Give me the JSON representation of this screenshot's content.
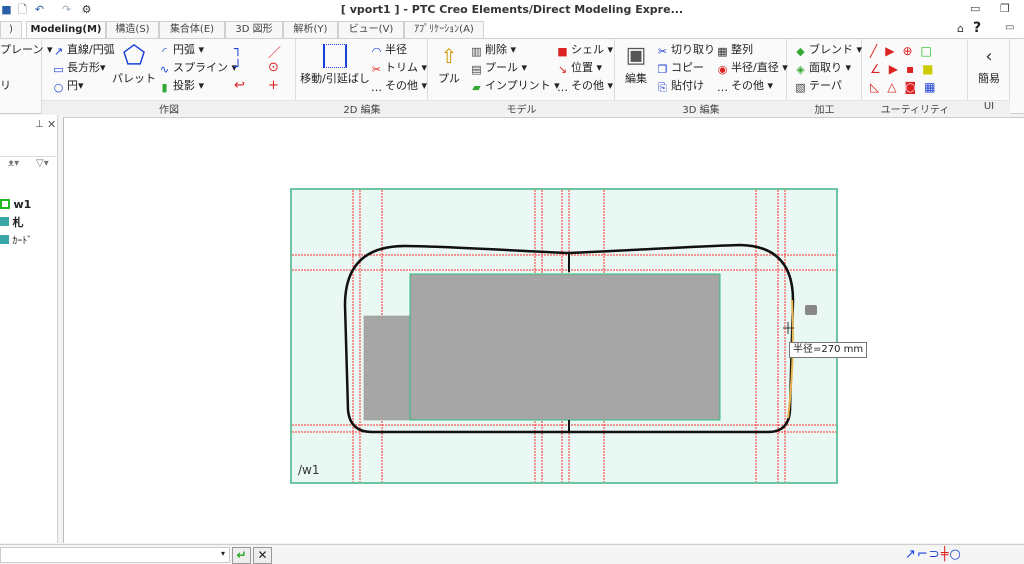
{
  "window": {
    "title": "[ vport1 ] - PTC Creo Elements/Direct Modeling Expre..."
  },
  "quick_access": [
    {
      "icon": "save-icon"
    },
    {
      "icon": "print-preview-icon"
    },
    {
      "icon": "undo-icon"
    },
    {
      "icon": "redo-icon"
    },
    {
      "icon": "settings-icon"
    }
  ],
  "tabs": [
    {
      "label": ")"
    },
    {
      "label": "Modeling(M)",
      "active": true
    },
    {
      "label": "構造(S)"
    },
    {
      "label": "集合体(E)"
    },
    {
      "label": "3D 図形"
    },
    {
      "label": "解析(Y)"
    },
    {
      "label": "ビュー(V)"
    },
    {
      "label": "ｱﾌﾟﾘｹｰｼｮﾝ(A)"
    }
  ],
  "ribbon": {
    "partial": {
      "items": [
        "プレーン ▾",
        "リ"
      ]
    },
    "drawing": {
      "label": "作図",
      "items": [
        "直線/円弧",
        "長方形▾",
        "円▾",
        "パレット",
        "円弧 ▾",
        "スプライン ▾",
        "投影 ▾"
      ]
    },
    "edit2d": {
      "label": "2D 編集",
      "items": [
        "移動/引延ばし",
        "半径",
        "トリム ▾",
        "その他 ▾"
      ]
    },
    "model": {
      "label": "モデル",
      "items": [
        "プル",
        "削除 ▾",
        "プール ▾",
        "インプリント ▾",
        "シェル ▾",
        "位置 ▾",
        "その他 ▾"
      ]
    },
    "edit3d": {
      "label": "3D 編集",
      "items": [
        "編集",
        "切り取り",
        "コピー",
        "貼付け",
        "整列",
        "半径/直径 ▾",
        "その他 ▾"
      ]
    },
    "machining": {
      "label": "加工",
      "items": [
        "ブレンド ▾",
        "面取り ▾",
        "テーパ"
      ]
    },
    "utility": {
      "label": "ユーティリティ"
    },
    "ui": {
      "label": "UI",
      "items": [
        "簡易"
      ]
    }
  },
  "tree": {
    "items": [
      {
        "label": "w1",
        "icon": "workplane-icon"
      },
      {
        "label": "札",
        "icon": "part-icon"
      },
      {
        "label": "ｶｰﾄﾞ",
        "icon": "part-icon"
      }
    ]
  },
  "viewport": {
    "workplane_label": "/w1",
    "tooltip": "半径=270 mm",
    "colors": {
      "workplane": "#eaf8f4",
      "border": "#6cc4a0",
      "grid": "#ff3030",
      "face": "#a6a6a6",
      "highlight": "#e8b450"
    }
  },
  "command": {
    "value": ""
  }
}
